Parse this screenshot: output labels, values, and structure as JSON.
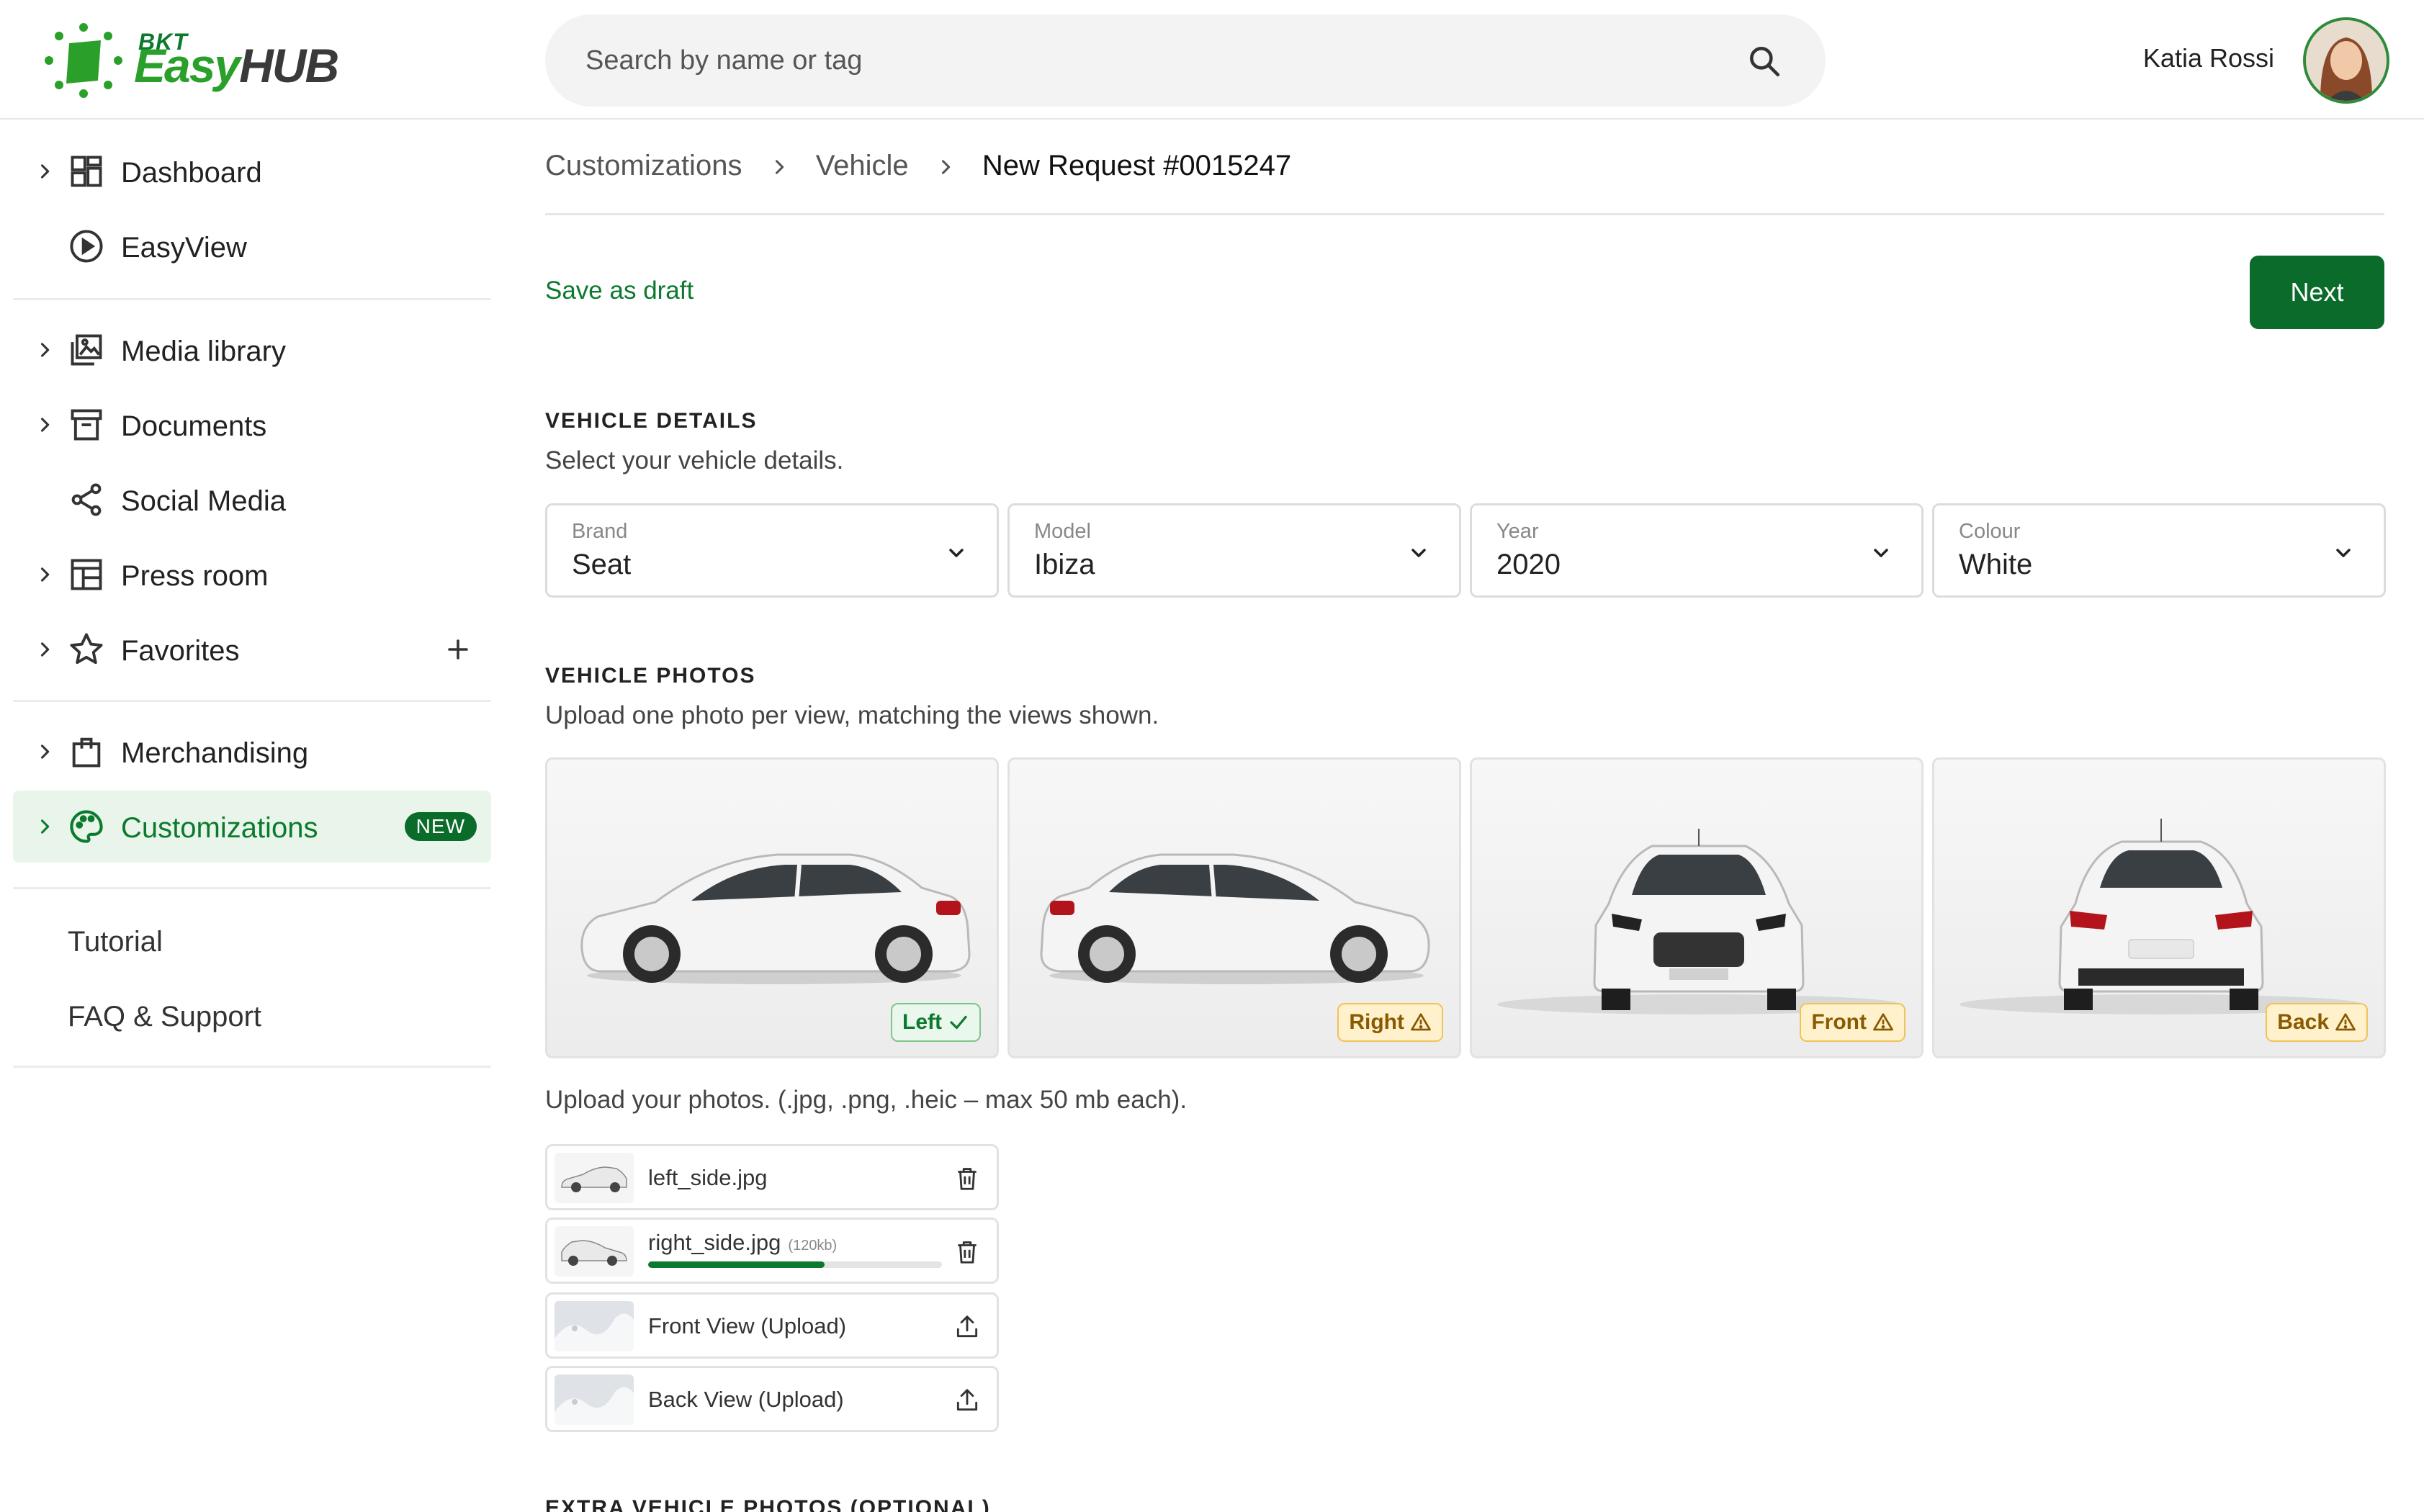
{
  "brand": {
    "logo_small": "BKT",
    "logo_easy": "Easy",
    "logo_hub": "HUB"
  },
  "search": {
    "placeholder": "Search by name or tag"
  },
  "user": {
    "name": "Katia Rossi"
  },
  "sidebar": {
    "items": [
      {
        "label": "Dashboard",
        "icon": "dashboard-icon"
      },
      {
        "label": "EasyView",
        "icon": "play-circle-icon"
      },
      {
        "label": "Media library",
        "icon": "media-library-icon"
      },
      {
        "label": "Documents",
        "icon": "archive-box-icon"
      },
      {
        "label": "Social Media",
        "icon": "share-icon"
      },
      {
        "label": "Press room",
        "icon": "newspaper-icon"
      },
      {
        "label": "Favorites",
        "icon": "star-icon"
      },
      {
        "label": "Merchandising",
        "icon": "shopping-bag-icon"
      },
      {
        "label": "Customizations",
        "icon": "palette-icon",
        "badge": "NEW",
        "active": true
      }
    ],
    "footer_links": [
      "Tutorial",
      "FAQ & Support"
    ]
  },
  "breadcrumb": [
    "Customizations",
    "Vehicle",
    "New Request #0015247"
  ],
  "actions": {
    "save_draft": "Save as draft",
    "next": "Next"
  },
  "vehicle_details": {
    "title": "VEHICLE DETAILS",
    "subtitle": "Select your vehicle details.",
    "fields": [
      {
        "label": "Brand",
        "value": "Seat"
      },
      {
        "label": "Model",
        "value": "Ibiza"
      },
      {
        "label": "Year",
        "value": "2020"
      },
      {
        "label": "Colour",
        "value": "White"
      }
    ]
  },
  "vehicle_photos": {
    "title": "VEHICLE PHOTOS",
    "subtitle": "Upload one photo per view, matching the views shown.",
    "views": [
      {
        "label": "Left",
        "status": "ok"
      },
      {
        "label": "Right",
        "status": "warn"
      },
      {
        "label": "Front",
        "status": "warn"
      },
      {
        "label": "Back",
        "status": "warn"
      }
    ],
    "upload_note": "Upload your photos. (.jpg, .png, .heic – max 50 mb each).",
    "files": [
      {
        "name": "left_side.jpg",
        "size": "",
        "action": "trash-icon"
      },
      {
        "name": "right_side.jpg",
        "size": "(120kb)",
        "progress": 0.6,
        "action": "trash-icon"
      },
      {
        "name": "Front View (Upload)",
        "size": "",
        "action": "upload-icon"
      },
      {
        "name": "Back View (Upload)",
        "size": "",
        "action": "upload-icon"
      }
    ]
  },
  "extra_photos": {
    "title": "EXTRA VEHICLE PHOTOS (OPTIONAL)"
  },
  "colors": {
    "brand_green": "#0b6b2a",
    "active_bg": "#e9f5ea",
    "warn_bg": "#fff1cc",
    "ok_bg": "#eaf7ec"
  }
}
